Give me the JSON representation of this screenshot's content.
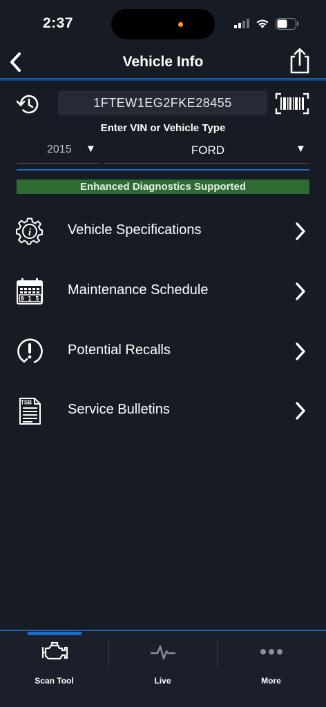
{
  "status_bar": {
    "time": "2:37"
  },
  "nav": {
    "title": "Vehicle Info"
  },
  "vin": {
    "value": "1FTEW1EG2FKE28455",
    "hint": "Enter VIN or Vehicle Type"
  },
  "vehicle": {
    "year": "2015",
    "make": "FORD"
  },
  "banner": {
    "text": "Enhanced Diagnostics Supported",
    "color": "#2e6b32"
  },
  "menu": {
    "items": [
      {
        "label": "Vehicle Specifications",
        "icon": "gear-info-icon"
      },
      {
        "label": "Maintenance Schedule",
        "icon": "calendar-odometer-icon"
      },
      {
        "label": "Potential Recalls",
        "icon": "recall-alert-icon"
      },
      {
        "label": "Service Bulletins",
        "icon": "tsb-document-icon"
      }
    ]
  },
  "calendar_odometer": "0 1 5",
  "tsb_icon_text": "TSB",
  "tabs": [
    {
      "label": "Scan Tool",
      "icon": "engine-icon",
      "active": true
    },
    {
      "label": "Live",
      "icon": "pulse-icon",
      "active": false
    },
    {
      "label": "More",
      "icon": "more-dots-icon",
      "active": false
    }
  ],
  "colors": {
    "background": "#171b24",
    "accent": "#1565c0",
    "island_dot": "#ff9330"
  }
}
